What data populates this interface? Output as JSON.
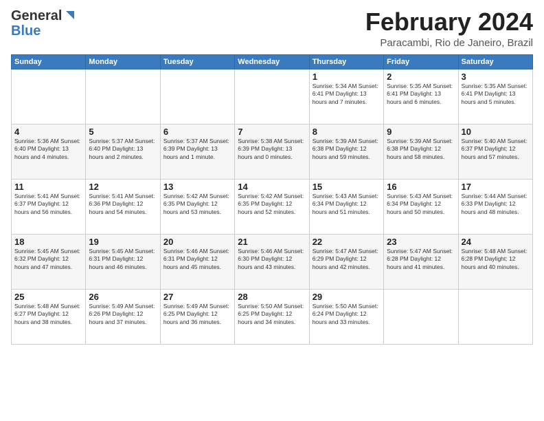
{
  "header": {
    "logo_general": "General",
    "logo_blue": "Blue",
    "month_title": "February 2024",
    "location": "Paracambi, Rio de Janeiro, Brazil"
  },
  "days_of_week": [
    "Sunday",
    "Monday",
    "Tuesday",
    "Wednesday",
    "Thursday",
    "Friday",
    "Saturday"
  ],
  "weeks": [
    [
      {
        "day": "",
        "info": ""
      },
      {
        "day": "",
        "info": ""
      },
      {
        "day": "",
        "info": ""
      },
      {
        "day": "",
        "info": ""
      },
      {
        "day": "1",
        "info": "Sunrise: 5:34 AM\nSunset: 6:41 PM\nDaylight: 13 hours\nand 7 minutes."
      },
      {
        "day": "2",
        "info": "Sunrise: 5:35 AM\nSunset: 6:41 PM\nDaylight: 13 hours\nand 6 minutes."
      },
      {
        "day": "3",
        "info": "Sunrise: 5:35 AM\nSunset: 6:41 PM\nDaylight: 13 hours\nand 5 minutes."
      }
    ],
    [
      {
        "day": "4",
        "info": "Sunrise: 5:36 AM\nSunset: 6:40 PM\nDaylight: 13 hours\nand 4 minutes."
      },
      {
        "day": "5",
        "info": "Sunrise: 5:37 AM\nSunset: 6:40 PM\nDaylight: 13 hours\nand 2 minutes."
      },
      {
        "day": "6",
        "info": "Sunrise: 5:37 AM\nSunset: 6:39 PM\nDaylight: 13 hours\nand 1 minute."
      },
      {
        "day": "7",
        "info": "Sunrise: 5:38 AM\nSunset: 6:39 PM\nDaylight: 13 hours\nand 0 minutes."
      },
      {
        "day": "8",
        "info": "Sunrise: 5:39 AM\nSunset: 6:38 PM\nDaylight: 12 hours\nand 59 minutes."
      },
      {
        "day": "9",
        "info": "Sunrise: 5:39 AM\nSunset: 6:38 PM\nDaylight: 12 hours\nand 58 minutes."
      },
      {
        "day": "10",
        "info": "Sunrise: 5:40 AM\nSunset: 6:37 PM\nDaylight: 12 hours\nand 57 minutes."
      }
    ],
    [
      {
        "day": "11",
        "info": "Sunrise: 5:41 AM\nSunset: 6:37 PM\nDaylight: 12 hours\nand 56 minutes."
      },
      {
        "day": "12",
        "info": "Sunrise: 5:41 AM\nSunset: 6:36 PM\nDaylight: 12 hours\nand 54 minutes."
      },
      {
        "day": "13",
        "info": "Sunrise: 5:42 AM\nSunset: 6:35 PM\nDaylight: 12 hours\nand 53 minutes."
      },
      {
        "day": "14",
        "info": "Sunrise: 5:42 AM\nSunset: 6:35 PM\nDaylight: 12 hours\nand 52 minutes."
      },
      {
        "day": "15",
        "info": "Sunrise: 5:43 AM\nSunset: 6:34 PM\nDaylight: 12 hours\nand 51 minutes."
      },
      {
        "day": "16",
        "info": "Sunrise: 5:43 AM\nSunset: 6:34 PM\nDaylight: 12 hours\nand 50 minutes."
      },
      {
        "day": "17",
        "info": "Sunrise: 5:44 AM\nSunset: 6:33 PM\nDaylight: 12 hours\nand 48 minutes."
      }
    ],
    [
      {
        "day": "18",
        "info": "Sunrise: 5:45 AM\nSunset: 6:32 PM\nDaylight: 12 hours\nand 47 minutes."
      },
      {
        "day": "19",
        "info": "Sunrise: 5:45 AM\nSunset: 6:31 PM\nDaylight: 12 hours\nand 46 minutes."
      },
      {
        "day": "20",
        "info": "Sunrise: 5:46 AM\nSunset: 6:31 PM\nDaylight: 12 hours\nand 45 minutes."
      },
      {
        "day": "21",
        "info": "Sunrise: 5:46 AM\nSunset: 6:30 PM\nDaylight: 12 hours\nand 43 minutes."
      },
      {
        "day": "22",
        "info": "Sunrise: 5:47 AM\nSunset: 6:29 PM\nDaylight: 12 hours\nand 42 minutes."
      },
      {
        "day": "23",
        "info": "Sunrise: 5:47 AM\nSunset: 6:28 PM\nDaylight: 12 hours\nand 41 minutes."
      },
      {
        "day": "24",
        "info": "Sunrise: 5:48 AM\nSunset: 6:28 PM\nDaylight: 12 hours\nand 40 minutes."
      }
    ],
    [
      {
        "day": "25",
        "info": "Sunrise: 5:48 AM\nSunset: 6:27 PM\nDaylight: 12 hours\nand 38 minutes."
      },
      {
        "day": "26",
        "info": "Sunrise: 5:49 AM\nSunset: 6:26 PM\nDaylight: 12 hours\nand 37 minutes."
      },
      {
        "day": "27",
        "info": "Sunrise: 5:49 AM\nSunset: 6:25 PM\nDaylight: 12 hours\nand 36 minutes."
      },
      {
        "day": "28",
        "info": "Sunrise: 5:50 AM\nSunset: 6:25 PM\nDaylight: 12 hours\nand 34 minutes."
      },
      {
        "day": "29",
        "info": "Sunrise: 5:50 AM\nSunset: 6:24 PM\nDaylight: 12 hours\nand 33 minutes."
      },
      {
        "day": "",
        "info": ""
      },
      {
        "day": "",
        "info": ""
      }
    ]
  ]
}
